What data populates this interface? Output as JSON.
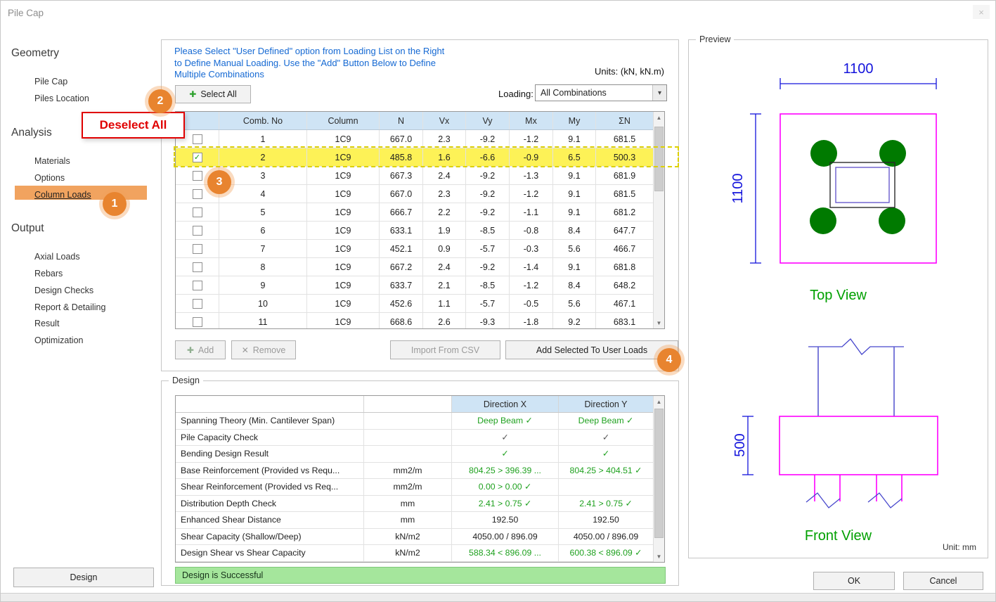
{
  "window": {
    "title": "Pile Cap",
    "close_glyph": "×"
  },
  "sidebar": {
    "sections": [
      {
        "title": "Geometry",
        "items": [
          {
            "label": "Pile Cap"
          },
          {
            "label": "Piles Location"
          }
        ]
      },
      {
        "title": "Analysis",
        "items": [
          {
            "label": "Materials"
          },
          {
            "label": "Options"
          },
          {
            "label": "Column Loads"
          }
        ]
      },
      {
        "title": "Output",
        "items": [
          {
            "label": "Axial Loads"
          },
          {
            "label": "Rebars"
          },
          {
            "label": "Design Checks"
          },
          {
            "label": "Report & Detailing"
          },
          {
            "label": "Result"
          },
          {
            "label": "Optimization"
          }
        ]
      }
    ],
    "active_item": "Column Loads",
    "design_button": "Design"
  },
  "icons": {
    "plus": "✚",
    "x": "✕",
    "up": "▲",
    "down": "▼",
    "down_small": "▾"
  },
  "loads": {
    "instruction": "Please Select \"User Defined\" option from Loading List on the Right to Define Manual Loading. Use the \"Add\" Button Below to Define Multiple Combinations",
    "units_label": "Units: (kN, kN.m)",
    "select_all": "Select All",
    "loading_label": "Loading:",
    "loading_value": "All Combinations",
    "add": "Add",
    "remove": "Remove",
    "import_csv": "Import From CSV",
    "add_selected": "Add Selected To User Loads",
    "table": {
      "headers": {
        "comb": "Comb. No",
        "col": "Column",
        "n": "N",
        "vx": "Vx",
        "vy": "Vy",
        "mx": "Mx",
        "my": "My",
        "sn": "ΣN"
      },
      "rows": [
        {
          "checked": false,
          "comb": "1",
          "col": "1C9",
          "n": "667.0",
          "vx": "2.3",
          "vy": "-9.2",
          "mx": "-1.2",
          "my": "9.1",
          "sn": "681.5"
        },
        {
          "checked": true,
          "comb": "2",
          "col": "1C9",
          "n": "485.8",
          "vx": "1.6",
          "vy": "-6.6",
          "mx": "-0.9",
          "my": "6.5",
          "sn": "500.3"
        },
        {
          "checked": false,
          "comb": "3",
          "col": "1C9",
          "n": "667.3",
          "vx": "2.4",
          "vy": "-9.2",
          "mx": "-1.3",
          "my": "9.1",
          "sn": "681.9"
        },
        {
          "checked": false,
          "comb": "4",
          "col": "1C9",
          "n": "667.0",
          "vx": "2.3",
          "vy": "-9.2",
          "mx": "-1.2",
          "my": "9.1",
          "sn": "681.5"
        },
        {
          "checked": false,
          "comb": "5",
          "col": "1C9",
          "n": "666.7",
          "vx": "2.2",
          "vy": "-9.2",
          "mx": "-1.1",
          "my": "9.1",
          "sn": "681.2"
        },
        {
          "checked": false,
          "comb": "6",
          "col": "1C9",
          "n": "633.1",
          "vx": "1.9",
          "vy": "-8.5",
          "mx": "-0.8",
          "my": "8.4",
          "sn": "647.7"
        },
        {
          "checked": false,
          "comb": "7",
          "col": "1C9",
          "n": "452.1",
          "vx": "0.9",
          "vy": "-5.7",
          "mx": "-0.3",
          "my": "5.6",
          "sn": "466.7"
        },
        {
          "checked": false,
          "comb": "8",
          "col": "1C9",
          "n": "667.2",
          "vx": "2.4",
          "vy": "-9.2",
          "mx": "-1.4",
          "my": "9.1",
          "sn": "681.8"
        },
        {
          "checked": false,
          "comb": "9",
          "col": "1C9",
          "n": "633.7",
          "vx": "2.1",
          "vy": "-8.5",
          "mx": "-1.2",
          "my": "8.4",
          "sn": "648.2"
        },
        {
          "checked": false,
          "comb": "10",
          "col": "1C9",
          "n": "452.6",
          "vx": "1.1",
          "vy": "-5.7",
          "mx": "-0.5",
          "my": "5.6",
          "sn": "467.1"
        },
        {
          "checked": false,
          "comb": "11",
          "col": "1C9",
          "n": "668.6",
          "vx": "2.6",
          "vy": "-9.3",
          "mx": "-1.8",
          "my": "9.2",
          "sn": "683.1"
        }
      ]
    }
  },
  "design": {
    "title": "Design",
    "headers": {
      "dx": "Direction X",
      "dy": "Direction Y"
    },
    "rows": [
      {
        "label": "Spanning Theory (Min. Cantilever Span)",
        "unit": "",
        "dx": "Deep Beam ✓",
        "dy": "Deep Beam ✓",
        "dx_color": "green",
        "dy_color": "green"
      },
      {
        "label": "Pile Capacity Check",
        "unit": "",
        "dx": "✓",
        "dy": "✓",
        "dx_color": "dim",
        "dy_color": "dim"
      },
      {
        "label": "Bending Design Result",
        "unit": "",
        "dx": "✓",
        "dy": "✓",
        "dx_color": "green",
        "dy_color": "green"
      },
      {
        "label": "Base Reinforcement (Provided vs Requ...",
        "unit": "mm2/m",
        "dx": "804.25 > 396.39 ...",
        "dy": "804.25 > 404.51 ✓",
        "dx_color": "green",
        "dy_color": "green"
      },
      {
        "label": "Shear Reinforcement (Provided vs Req...",
        "unit": "mm2/m",
        "dx": "0.00 > 0.00 ✓",
        "dy": "",
        "dx_color": "green",
        "dy_color": "green"
      },
      {
        "label": "Distribution Depth Check",
        "unit": "mm",
        "dx": "2.41 > 0.75 ✓",
        "dy": "2.41 > 0.75 ✓",
        "dx_color": "green",
        "dy_color": "green"
      },
      {
        "label": "Enhanced Shear Distance",
        "unit": "mm",
        "dx": "192.50",
        "dy": "192.50",
        "dx_color": "plain",
        "dy_color": "plain"
      },
      {
        "label": "Shear Capacity (Shallow/Deep)",
        "unit": "kN/m2",
        "dx": "4050.00 / 896.09",
        "dy": "4050.00 / 896.09",
        "dx_color": "plain",
        "dy_color": "plain"
      },
      {
        "label": "Design Shear vs Shear Capacity",
        "unit": "kN/m2",
        "dx": "588.34 < 896.09 ...",
        "dy": "600.38 < 896.09 ✓",
        "dx_color": "green",
        "dy_color": "green"
      }
    ],
    "status": "Design is Successful"
  },
  "preview": {
    "title": "Preview",
    "top_width": "1100",
    "top_height": "1100",
    "front_depth": "500",
    "top_view": "Top View",
    "front_view": "Front View",
    "unit": "Unit: mm"
  },
  "footer": {
    "ok": "OK",
    "cancel": "Cancel"
  },
  "annotations": {
    "step1": "1",
    "step2": "2",
    "step3": "3",
    "step4": "4",
    "deselect_all": "Deselect All"
  },
  "colors": {
    "accent_orange": "#e8842f",
    "active_highlight": "#f1a35f",
    "row_highlight": "#fdf257",
    "header_blue": "#cfe4f5",
    "success_green": "#a5e69c",
    "drawing_blue": "#1414dc",
    "drawing_magenta": "#ff00ff",
    "pile_green": "#007a00",
    "view_label_green": "#00a000",
    "annotation_red": "#e00000",
    "instruction_blue": "#1569d3"
  }
}
